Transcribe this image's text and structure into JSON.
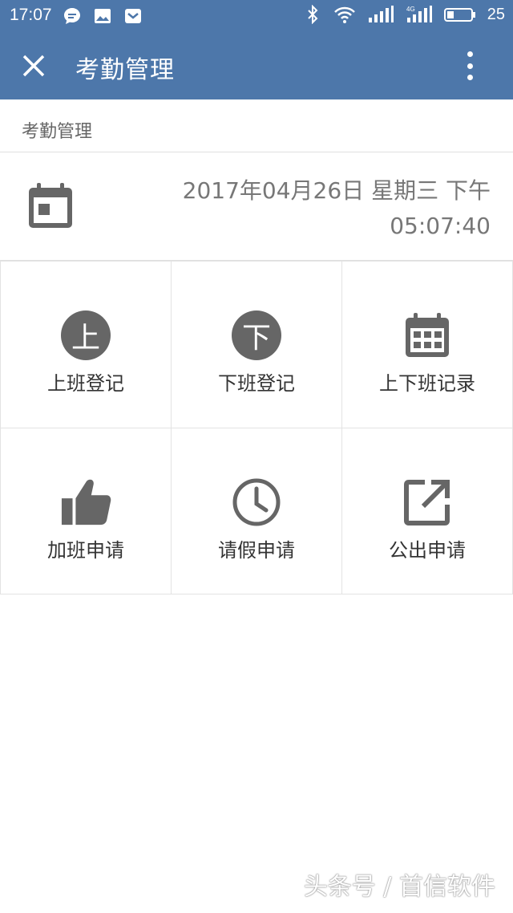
{
  "status_bar": {
    "time": "17:07",
    "battery": "25",
    "network": "4G",
    "icons": [
      "chat-icon",
      "image-icon",
      "mail-icon",
      "bluetooth-icon",
      "wifi-icon",
      "signal-icon",
      "battery-icon"
    ]
  },
  "app_bar": {
    "title": "考勤管理",
    "close_icon": "close-icon",
    "more_icon": "more-vert-icon"
  },
  "breadcrumb": "考勤管理",
  "date": {
    "line1": "2017年04月26日 星期三 下午",
    "line2": "05:07:40"
  },
  "grid": [
    {
      "label": "上班登记",
      "icon": "check-in-icon",
      "glyph": "上"
    },
    {
      "label": "下班登记",
      "icon": "check-out-icon",
      "glyph": "下"
    },
    {
      "label": "上下班记录",
      "icon": "calendar-icon"
    },
    {
      "label": "加班申请",
      "icon": "thumbs-up-icon"
    },
    {
      "label": "请假申请",
      "icon": "clock-icon"
    },
    {
      "label": "公出申请",
      "icon": "external-link-icon"
    }
  ],
  "watermark": "头条号 / 首信软件",
  "colors": {
    "primary": "#4d77aa",
    "icon_gray": "#666666",
    "text_gray": "#777777",
    "divider": "#e3e3e3"
  }
}
